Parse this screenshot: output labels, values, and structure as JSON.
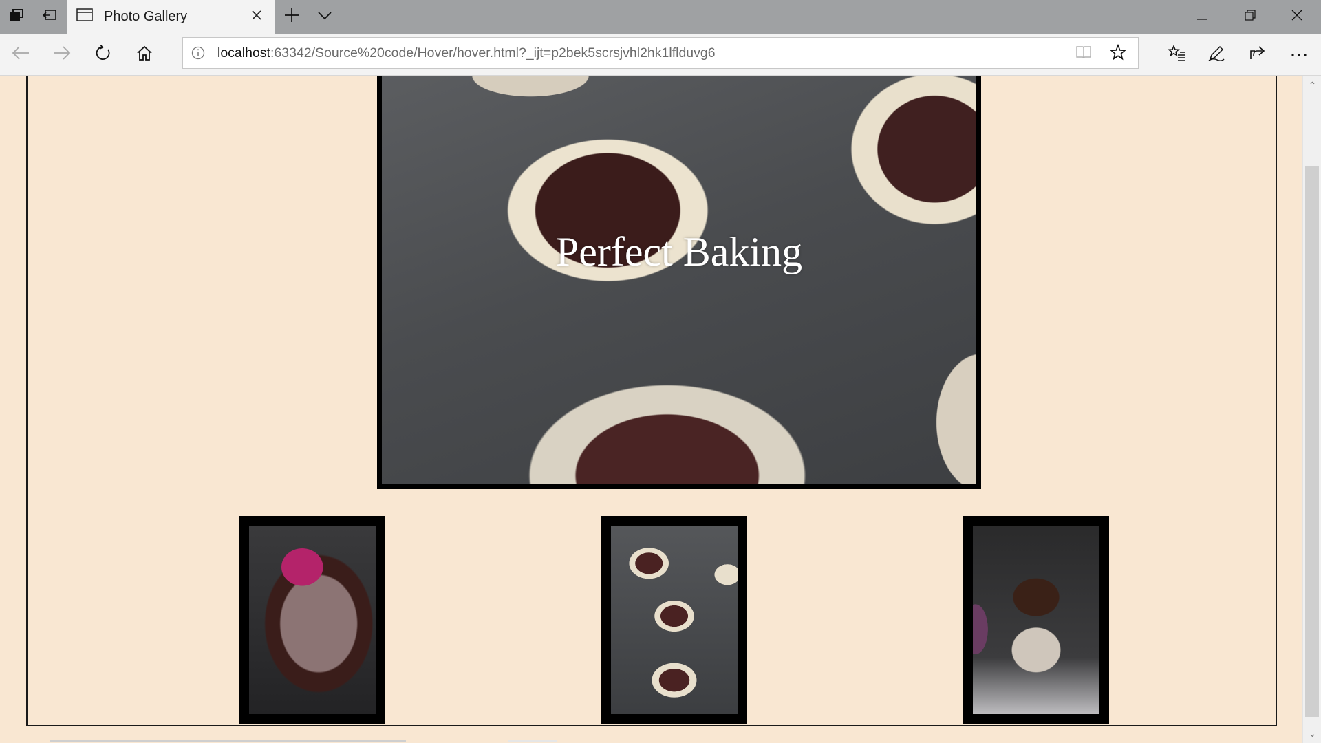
{
  "browser": {
    "tab_title": "Photo Gallery",
    "url_host": "localhost",
    "url_rest": ":63342/Source%20code/Hover/hover.html?_ijt=p2bek5scrsjvhl2hk1lflduvg6",
    "icons": {
      "tab_actions": "tabs-aside-icon",
      "set_aside": "set-tabs-aside-icon",
      "page": "page-icon",
      "close_tab": "close-icon",
      "new_tab": "plus-icon",
      "tab_list": "chevron-down-icon",
      "minimize": "minimize-icon",
      "restore": "restore-icon",
      "close_window": "close-icon",
      "back": "back-arrow-icon",
      "forward": "forward-arrow-icon",
      "refresh": "refresh-icon",
      "home": "home-icon",
      "info": "info-icon",
      "reading_view": "book-icon",
      "favorite": "star-icon",
      "favorites_hub": "favorites-icon",
      "notes": "pen-icon",
      "share": "share-icon",
      "more": "more-icon"
    }
  },
  "gallery": {
    "hero_caption": "Perfect Baking",
    "thumbnails": [
      {
        "subject": "chocolate batter with spatula"
      },
      {
        "subject": "filled cupcake liners in tin"
      },
      {
        "subject": "frosted chocolate cupcake"
      }
    ]
  },
  "colors": {
    "page_background": "#f9e7d2",
    "frame_border": "#1a1a1a",
    "image_border": "#000000",
    "caption_text": "#ffffff"
  }
}
